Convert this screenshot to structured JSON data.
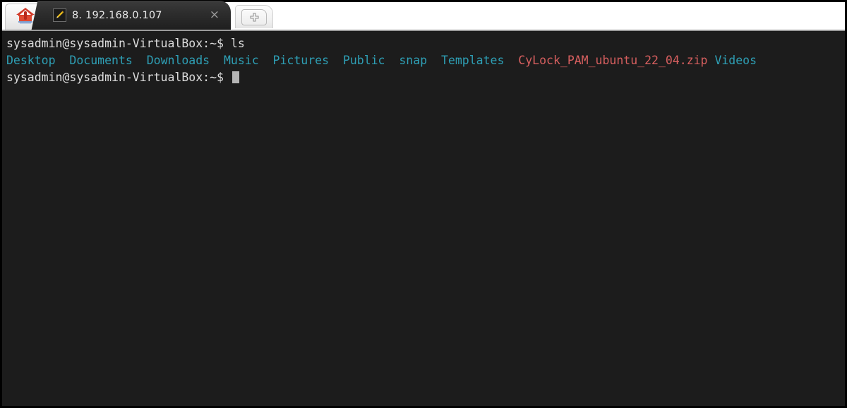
{
  "window": {
    "background_color": "#1c1c1c",
    "border_color": "#000000"
  },
  "tabbar": {
    "background_color": "#ffffff",
    "home_tab": {
      "icon": "home-house-icon",
      "tooltip": ""
    },
    "active_tab": {
      "icon": "yellow-pencil-icon",
      "title": "8. 192.168.0.107",
      "close_label": "×",
      "background_color": "#2e2e2e",
      "title_color": "#e8e8e8"
    },
    "new_tab": {
      "icon": "plus-icon",
      "label": "+"
    }
  },
  "terminal": {
    "font_size_px": 16.5,
    "foreground_color": "#d8d8d8",
    "directory_color": "#2e9fb5",
    "archive_color": "#d75f5f",
    "lines": [
      {
        "type": "command",
        "segments": [
          {
            "text": "sysadmin@sysadmin-VirtualBox:~$ ",
            "color_class": "c-prompt"
          },
          {
            "text": "ls",
            "color_class": "c-prompt"
          }
        ]
      },
      {
        "type": "output",
        "segments": [
          {
            "text": "Desktop",
            "color_class": "c-dir"
          },
          {
            "text": "  ",
            "color_class": "c-prompt"
          },
          {
            "text": "Documents",
            "color_class": "c-dir"
          },
          {
            "text": "  ",
            "color_class": "c-prompt"
          },
          {
            "text": "Downloads",
            "color_class": "c-dir"
          },
          {
            "text": "  ",
            "color_class": "c-prompt"
          },
          {
            "text": "Music",
            "color_class": "c-dir"
          },
          {
            "text": "  ",
            "color_class": "c-prompt"
          },
          {
            "text": "Pictures",
            "color_class": "c-dir"
          },
          {
            "text": "  ",
            "color_class": "c-prompt"
          },
          {
            "text": "Public",
            "color_class": "c-dir"
          },
          {
            "text": "  ",
            "color_class": "c-prompt"
          },
          {
            "text": "snap",
            "color_class": "c-dir"
          },
          {
            "text": "  ",
            "color_class": "c-prompt"
          },
          {
            "text": "Templates",
            "color_class": "c-dir"
          },
          {
            "text": "  ",
            "color_class": "c-prompt"
          },
          {
            "text": "CyLock_PAM_ubuntu_22_04.zip",
            "color_class": "c-arch"
          },
          {
            "text": " ",
            "color_class": "c-prompt"
          },
          {
            "text": "Videos",
            "color_class": "c-dir"
          }
        ]
      },
      {
        "type": "prompt",
        "segments": [
          {
            "text": "sysadmin@sysadmin-VirtualBox:~$ ",
            "color_class": "c-prompt"
          }
        ],
        "cursor": true
      }
    ]
  }
}
